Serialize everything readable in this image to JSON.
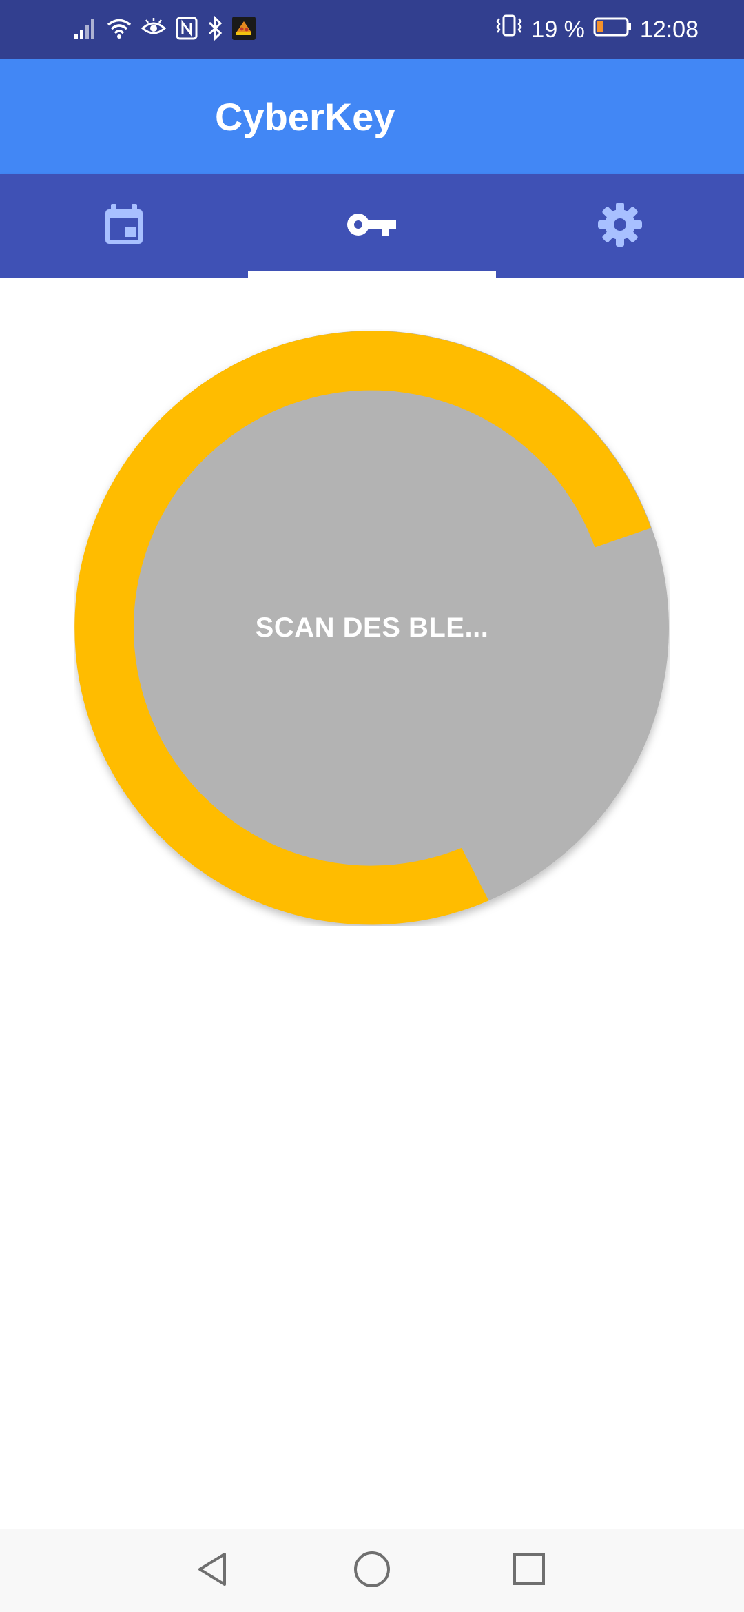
{
  "status_bar": {
    "battery_percent": "19 %",
    "battery_level": 0.19,
    "time": "12:08",
    "icons_left": [
      "signal-icon",
      "wifi-icon",
      "eye-icon",
      "nfc-icon",
      "bluetooth-icon",
      "app-notification-icon"
    ],
    "icons_right": [
      "vibrate-icon",
      "battery-icon"
    ]
  },
  "app_bar": {
    "title": "CyberKey"
  },
  "tabs": [
    {
      "icon": "calendar-icon",
      "selected": false
    },
    {
      "icon": "key-icon",
      "selected": true
    },
    {
      "icon": "gear-icon",
      "selected": false
    }
  ],
  "scan": {
    "label": "SCAN DES BLE...",
    "ring_color": "#FFBC00",
    "disc_color": "#B3B3B3"
  },
  "nav_bar": {
    "buttons": [
      "back-icon",
      "home-icon",
      "recents-icon"
    ]
  },
  "colors": {
    "status_bar": "#323F8F",
    "app_bar": "#4287F5",
    "tab_bar": "#3F51B5",
    "tab_icon_inactive": "#A8C0FF",
    "tab_icon_active": "#FFFFFF"
  }
}
